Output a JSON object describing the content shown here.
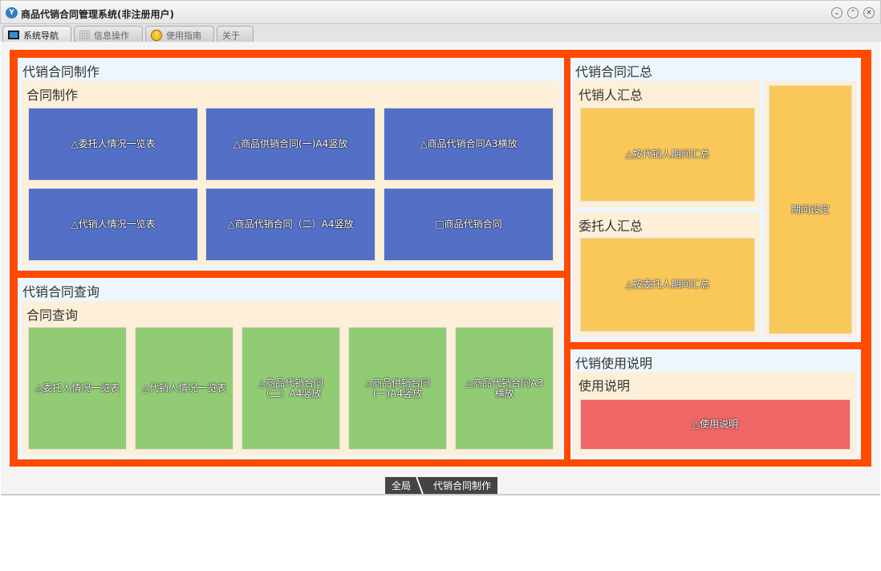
{
  "window": {
    "title": "商品代销合同管理系统(非注册用户)",
    "controls": [
      "⌄",
      "⌃",
      "✕"
    ]
  },
  "tabs": [
    {
      "label": "系统导航",
      "active": true
    },
    {
      "label": "信息操作"
    },
    {
      "label": "使用指南"
    },
    {
      "label": "关于"
    }
  ],
  "make": {
    "title": "代销合同制作",
    "sub": "合同制作",
    "tiles": [
      "△委托人情况一览表",
      "△商品供销合同(一)A4竖放",
      "△商品代销合同A3横放",
      "△代销人情况一览表",
      "△商品代销合同（二）A4竖放",
      "□商品代销合同"
    ]
  },
  "query": {
    "title": "代销合同查询",
    "sub": "合同查询",
    "tiles": [
      "△委托人情况一览表",
      "△代销人情况一览表",
      "△商品代销合同（二）A4竖放",
      "△商品供销合同(一)A4竖放",
      "△商品代销合同A3横放"
    ]
  },
  "summary": {
    "title": "代销合同汇总",
    "agent_sub": "代销人汇总",
    "agent_tile": "△按代销人期间汇总",
    "client_sub": "委托人汇总",
    "client_tile": "△按委托人期间汇总",
    "period_tile": "期间设定"
  },
  "help": {
    "title": "代销使用说明",
    "sub": "使用说明",
    "tile": "△使用说明"
  },
  "breadcrumb": [
    "全局",
    "代销合同制作"
  ],
  "colors": {
    "frame": "#ff4a00",
    "blue": "#5470c6",
    "green": "#91cc75",
    "yellow": "#fac858",
    "red": "#ee6666"
  }
}
